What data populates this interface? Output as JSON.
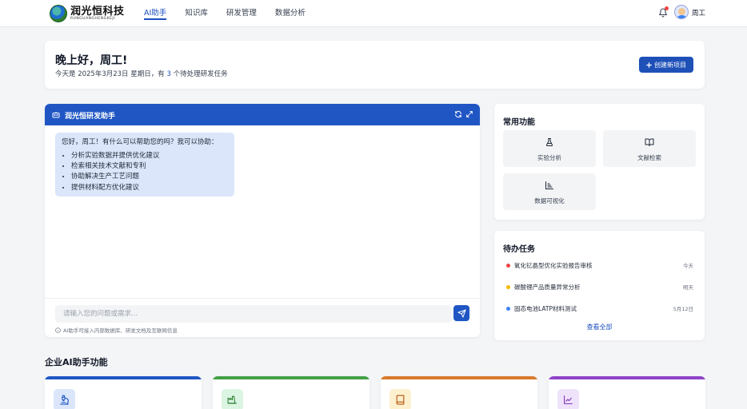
{
  "brand": {
    "name_cn": "润光恒科技",
    "name_en": "RUNGUANGHENGKEJI"
  },
  "nav": {
    "items": [
      "AI助手",
      "知识库",
      "研发管理",
      "数据分析"
    ],
    "active": "AI助手"
  },
  "user": {
    "name": "周工"
  },
  "greeting": {
    "title": "晚上好，周工!",
    "sub_prefix": "今天是 2025年3月23日 星期日，有 ",
    "pending_count": "3",
    "sub_suffix": " 个待处理研发任务",
    "new_project_label": "创建新项目"
  },
  "assistant": {
    "title": "润光恒研发助手",
    "intro": "您好，周工！有什么可以帮助您的吗？我可以协助：",
    "capabilities": [
      "分析实验数据并提供优化建议",
      "检索相关技术文献和专利",
      "协助解决生产工艺问题",
      "提供材料配方优化建议"
    ],
    "input_placeholder": "请输入您的问题或需求...",
    "note": "AI助手可接入内部数据库、研发文档及互联网信息"
  },
  "common_functions": {
    "title": "常用功能",
    "items": [
      {
        "label": "实验分析",
        "icon": "flask-icon"
      },
      {
        "label": "文献检索",
        "icon": "book-open-icon"
      },
      {
        "label": "数据可视化",
        "icon": "bar-chart-icon"
      }
    ]
  },
  "todos": {
    "title": "待办任务",
    "items": [
      {
        "text": "氧化钇晶型优化实验报告审核",
        "date": "今天",
        "color": "#ef4444"
      },
      {
        "text": "碳酸锂产品质量异常分析",
        "date": "明天",
        "color": "#f5b800"
      },
      {
        "text": "固态电池LATP材料测试",
        "date": "5月12日",
        "color": "#3b82f6"
      }
    ],
    "view_all": "查看全部"
  },
  "enterprise": {
    "title": "企业AI助手功能",
    "cards": [
      {
        "accent": "#1f56c4",
        "icon": "microscope-icon",
        "icon_bg": "#dbe6fa"
      },
      {
        "accent": "#43a047",
        "icon": "factory-icon",
        "icon_bg": "#dcf5e2"
      },
      {
        "accent": "#d97a2b",
        "icon": "notebook-icon",
        "icon_bg": "#fdf0cf"
      },
      {
        "accent": "#8e44c9",
        "icon": "line-chart-icon",
        "icon_bg": "#efe3fb"
      }
    ]
  },
  "colors": {
    "primary": "#1f56c4",
    "page_bg": "#f4f5f7"
  }
}
